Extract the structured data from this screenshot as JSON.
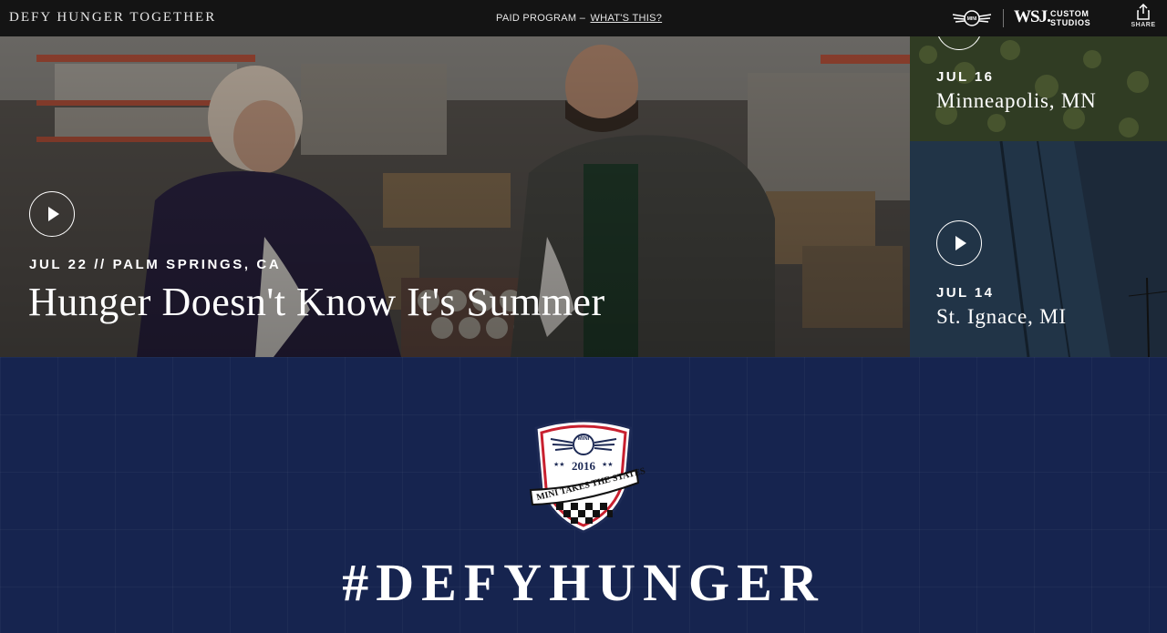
{
  "header": {
    "site_title": "DEFY HUNGER TOGETHER",
    "paid_label": "PAID PROGRAM –",
    "whats_this": "WHAT'S THIS?",
    "wsj_label": "WSJ.",
    "custom_studios_line1": "CUSTOM",
    "custom_studios_line2": "STUDIOS",
    "mini_logo_text": "MINI",
    "share_label": "SHARE"
  },
  "hero": {
    "meta": "JUL 22 // PALM SPRINGS, CA",
    "title": "Hunger Doesn't Know It's Summer"
  },
  "cards": [
    {
      "date": "JUL 16",
      "place": "Minneapolis, MN"
    },
    {
      "date": "JUL 14",
      "place": "St. Ignace, MI"
    }
  ],
  "badge": {
    "mini": "MINI",
    "year": "2016",
    "stars": "★★",
    "tagline": "MINI TAKES THE STATES"
  },
  "banner": {
    "hashtag": "#DEFYHUNGER"
  },
  "colors": {
    "topbar": "#141414",
    "banner": "#16244f",
    "badge_red": "#c8202f"
  },
  "icons": {
    "play": "play-icon",
    "share": "share-icon",
    "mini": "mini-wings-logo"
  }
}
